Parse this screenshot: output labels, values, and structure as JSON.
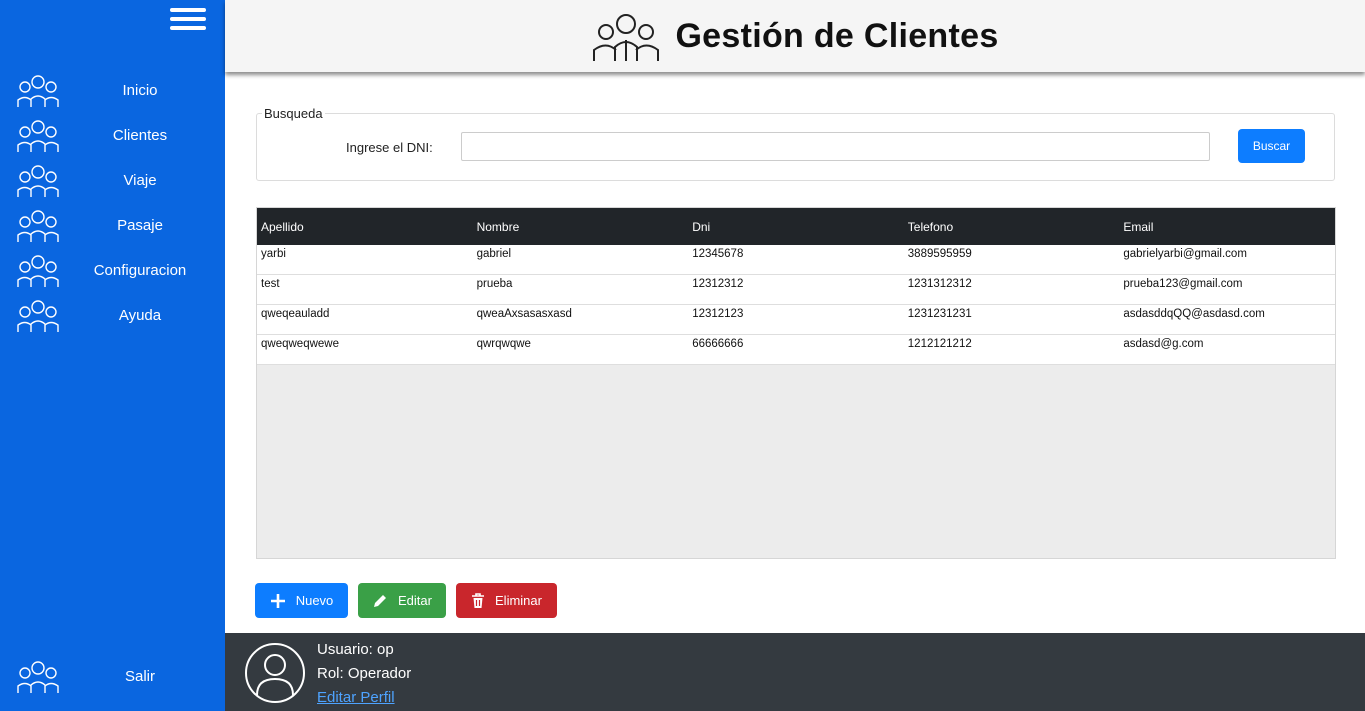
{
  "sidebar": {
    "menu_icon": "hamburger-icon",
    "items": [
      {
        "label": "Inicio",
        "icon": "group-icon"
      },
      {
        "label": "Clientes",
        "icon": "group-icon"
      },
      {
        "label": "Viaje",
        "icon": "group-icon"
      },
      {
        "label": "Pasaje",
        "icon": "group-icon"
      },
      {
        "label": "Configuracion",
        "icon": "group-icon"
      },
      {
        "label": "Ayuda",
        "icon": "group-icon"
      }
    ],
    "exit": {
      "label": "Salir",
      "icon": "group-icon"
    }
  },
  "header": {
    "title": "Gestión de Clientes",
    "icon": "clients-group-icon"
  },
  "search": {
    "legend": "Busqueda",
    "dni_label": "Ingrese el DNI:",
    "dni_value": "",
    "button_label": "Buscar"
  },
  "table": {
    "columns": [
      "Apellido",
      "Nombre",
      "Dni",
      "Telefono",
      "Email"
    ],
    "rows": [
      [
        "yarbi",
        "gabriel",
        "12345678",
        "3889595959",
        "gabrielyarbi@gmail.com"
      ],
      [
        "test",
        "prueba",
        "12312312",
        "1231312312",
        "prueba123@gmail.com"
      ],
      [
        "qweqeauladd",
        "qweaAxsasasxasd",
        "12312123",
        "1231231231",
        "asdasddqQQ@asdasd.com"
      ],
      [
        "qweqweqwewe",
        "qwrqwqwe",
        "66666666",
        "1212121212",
        "asdasd@g.com"
      ]
    ]
  },
  "actions": {
    "new_label": "Nuevo",
    "edit_label": "Editar",
    "delete_label": "Eliminar"
  },
  "footer": {
    "user": "Usuario: op",
    "role": "Rol: Operador",
    "edit_profile": "Editar Perfil",
    "avatar_icon": "user-avatar-icon"
  },
  "colors": {
    "sidebar": "#0a66e0",
    "primary": "#0d7dff",
    "success": "#3aa047",
    "danger": "#c9262c",
    "table_header": "#212529",
    "footer": "#343a40"
  }
}
